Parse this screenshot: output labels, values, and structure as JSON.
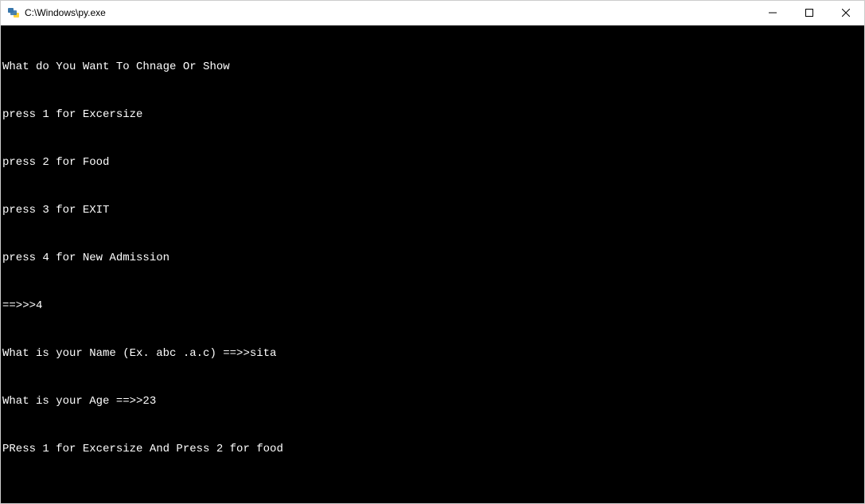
{
  "window": {
    "title": "C:\\Windows\\py.exe"
  },
  "terminal": {
    "lines": [
      "What do You Want To Chnage Or Show",
      "press 1 for Excersize",
      "press 2 for Food",
      "press 3 for EXIT",
      "press 4 for New Admission",
      "==>>>4",
      "What is your Name (Ex. abc .a.c) ==>>sita",
      "What is your Age ==>>23",
      "PRess 1 for Excersize And Press 2 for food"
    ]
  }
}
